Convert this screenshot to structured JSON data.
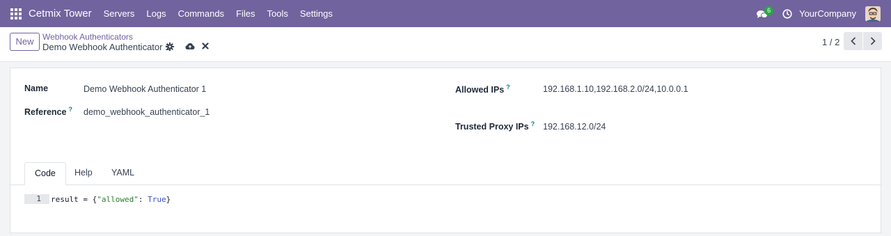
{
  "navbar": {
    "brand": "Cetmix Tower",
    "menu": [
      "Servers",
      "Logs",
      "Commands",
      "Files",
      "Tools",
      "Settings"
    ],
    "chat_badge": "6",
    "company": "YourCompany"
  },
  "control_panel": {
    "new_label": "New",
    "breadcrumb": "Webhook Authenticators",
    "record_title": "Demo Webhook Authenticator 1",
    "pager": "1 / 2"
  },
  "form": {
    "name_label": "Name",
    "name_value": "Demo Webhook Authenticator 1",
    "reference_label": "Reference",
    "reference_value": "demo_webhook_authenticator_1",
    "allowed_ips_label": "Allowed IPs",
    "allowed_ips_value": "192.168.1.10,192.168.2.0/24,10.0.0.1",
    "trusted_proxy_label": "Trusted Proxy IPs",
    "trusted_proxy_value": "192.168.12.0/24",
    "help_mark": "?"
  },
  "tabs": [
    "Code",
    "Help",
    "YAML"
  ],
  "code": {
    "line_number": "1",
    "prefix": "result = {",
    "key": "\"allowed\"",
    "colon": ": ",
    "value": "True",
    "suffix": "}"
  },
  "colors": {
    "navbar": "#71639e",
    "accent": "#71639e",
    "badge": "#28a745",
    "help": "#017e84"
  }
}
